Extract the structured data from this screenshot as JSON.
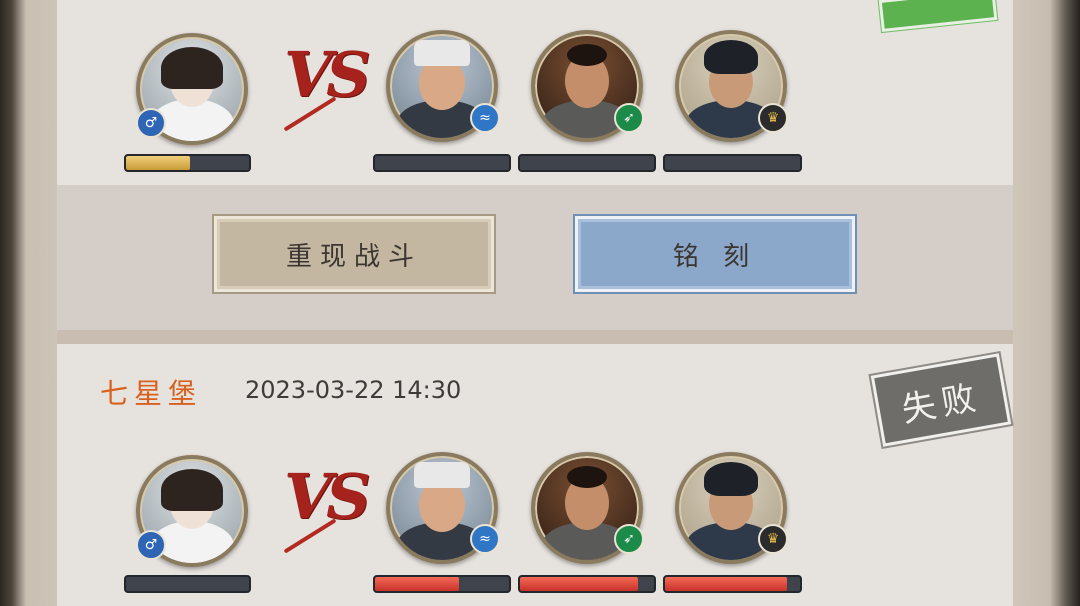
{
  "battle_top": {
    "players": {
      "left": {
        "badge_icon": "male-symbol-icon",
        "hp_fraction": 0.52
      },
      "right": [
        {
          "badge_icon": "water-spirit-icon",
          "hp_fraction": 0.0
        },
        {
          "badge_icon": "green-arrow-icon",
          "hp_fraction": 0.0
        },
        {
          "badge_icon": "gold-crest-icon",
          "hp_fraction": 0.0
        }
      ]
    },
    "vs_label": "VS"
  },
  "actions": {
    "replay_label": "重现战斗",
    "record_label": "铭 刻"
  },
  "battle_bottom": {
    "guild_name": "七星堡",
    "timestamp": "2023-03-22 14:30",
    "result_label": "失败",
    "vs_label": "VS",
    "players": {
      "left": {
        "badge_icon": "male-symbol-icon",
        "hp_fraction": 0.0
      },
      "right": [
        {
          "badge_icon": "water-spirit-icon",
          "hp_fraction": 0.63
        },
        {
          "badge_icon": "green-arrow-icon",
          "hp_fraction": 0.88
        },
        {
          "badge_icon": "gold-crest-icon",
          "hp_fraction": 0.9
        }
      ]
    }
  },
  "colors": {
    "accent_red": "#a5231c",
    "guild_orange": "#d8611f",
    "hp_gold": "#c89a36",
    "hp_red": "#c9322a",
    "replay_button": "#c4b7a1",
    "record_button": "#8ba7ca",
    "fail_stamp": "#6f6d6a",
    "win_stamp": "#5cb24f"
  }
}
